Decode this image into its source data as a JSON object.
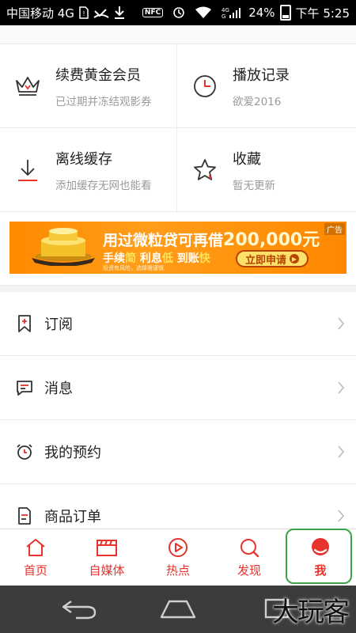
{
  "status_bar": {
    "carrier": "中国移动 4G",
    "battery": "24%",
    "time": "下午 5:25",
    "nfc": "NFC",
    "network": "4G"
  },
  "grid": [
    {
      "title": "续费黄金会员",
      "subtitle": "已过期并冻结观影券",
      "icon": "crown-icon"
    },
    {
      "title": "播放记录",
      "subtitle": "欲爱2016",
      "icon": "clock-icon"
    },
    {
      "title": "离线缓存",
      "subtitle": "添加缓存无网也能看",
      "icon": "download-icon"
    },
    {
      "title": "收藏",
      "subtitle": "暂无更新",
      "icon": "star-icon"
    }
  ],
  "ad": {
    "headline_pre": "用过微粒贷可再借",
    "amount": "200,000元",
    "tag1": "手续",
    "tag1_hl": "简",
    "tag2": " 利息",
    "tag2_hl": "低",
    "tag3": " 到账",
    "tag3_hl": "快",
    "button": "立即申请",
    "label": "广告",
    "fine": "投资有风险，选择需谨慎"
  },
  "list": [
    {
      "label": "订阅",
      "icon": "bookmark-icon"
    },
    {
      "label": "消息",
      "icon": "message-icon"
    },
    {
      "label": "我的预约",
      "icon": "alarm-clock-icon"
    },
    {
      "label": "商品订单",
      "icon": "order-icon"
    }
  ],
  "tabs": [
    {
      "label": "首页",
      "icon": "home-icon"
    },
    {
      "label": "自媒体",
      "icon": "clapperboard-icon"
    },
    {
      "label": "热点",
      "icon": "play-circle-icon"
    },
    {
      "label": "发现",
      "icon": "search-icon"
    },
    {
      "label": "我",
      "icon": "user-icon",
      "active": true
    }
  ],
  "watermark": "大玩客",
  "colors": {
    "accent": "#e8322d",
    "highlight": "#3ca34a",
    "ad": "#ff8a00"
  }
}
